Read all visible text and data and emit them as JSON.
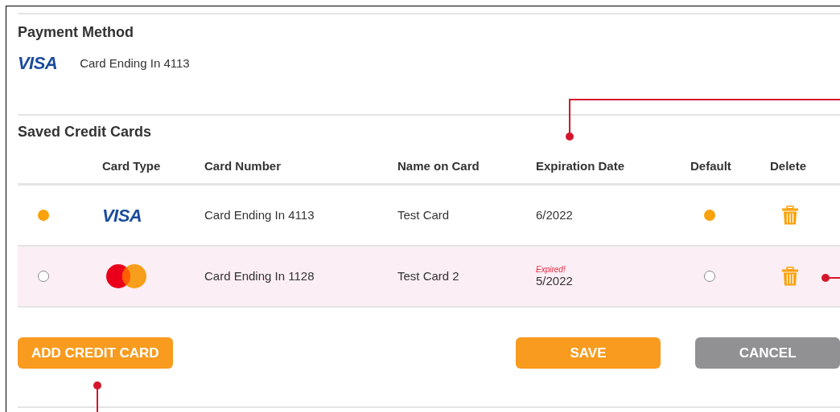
{
  "payment_method": {
    "title": "Payment Method",
    "card_brand": "VISA",
    "card_label": "Card Ending In 4113"
  },
  "saved_cards": {
    "title": "Saved Credit Cards",
    "columns": [
      "Card Type",
      "Card Number",
      "Name on Card",
      "Expiration Date",
      "Default",
      "Delete"
    ],
    "rows": [
      {
        "selected": true,
        "kind": "visa",
        "brand": "VISA",
        "number": "Card Ending In 4113",
        "name": "Test Card",
        "expiration": "6/2022",
        "expired": false,
        "default": true
      },
      {
        "selected": false,
        "kind": "mastercard",
        "number": "Card Ending In 1128",
        "name": "Test Card 2",
        "expiration": "5/2022",
        "expired": true,
        "expired_note": "Expired!",
        "default": false
      }
    ]
  },
  "buttons": {
    "add": "ADD CREDIT CARD",
    "save": "SAVE",
    "cancel": "CANCEL"
  }
}
